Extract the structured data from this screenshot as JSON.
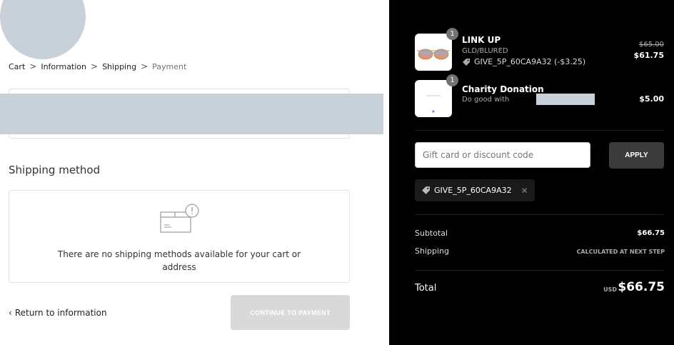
{
  "breadcrumb": {
    "items": [
      {
        "label": "Cart",
        "current": false
      },
      {
        "label": "Information",
        "current": false
      },
      {
        "label": "Shipping",
        "current": false
      },
      {
        "label": "Payment",
        "current": true
      }
    ],
    "separator": ">"
  },
  "shipping_method": {
    "title": "Shipping method",
    "empty_message": "There are no shipping methods available for your cart or address",
    "icon": "package-alert-icon"
  },
  "footer": {
    "return_label": "Return to information",
    "return_icon": "chevron-left-icon",
    "continue_label": "Continue to payment"
  },
  "order": {
    "items": [
      {
        "quantity": "1",
        "name": "LINK UP",
        "variant": "GLD/BLURED",
        "discount": "GIVE_5P_60CA9A32 (-$3.25)",
        "original_price": "$65.00",
        "price": "$61.75"
      },
      {
        "quantity": "1",
        "name": "Charity Donation",
        "variant": "Do good with",
        "price": "$5.00"
      }
    ],
    "discount_placeholder": "Gift card or discount code",
    "apply_label": "Apply",
    "applied_code": "GIVE_5P_60CA9A32",
    "subtotal_label": "Subtotal",
    "subtotal_value": "$66.75",
    "shipping_label": "Shipping",
    "shipping_value": "Calculated at next step",
    "total_label": "Total",
    "total_currency": "USD",
    "total_value": "$66.75"
  },
  "colors": {
    "summary_bg": "#000000",
    "redaction": "#c8d1d9",
    "disabled_button": "#d9d9d9"
  }
}
